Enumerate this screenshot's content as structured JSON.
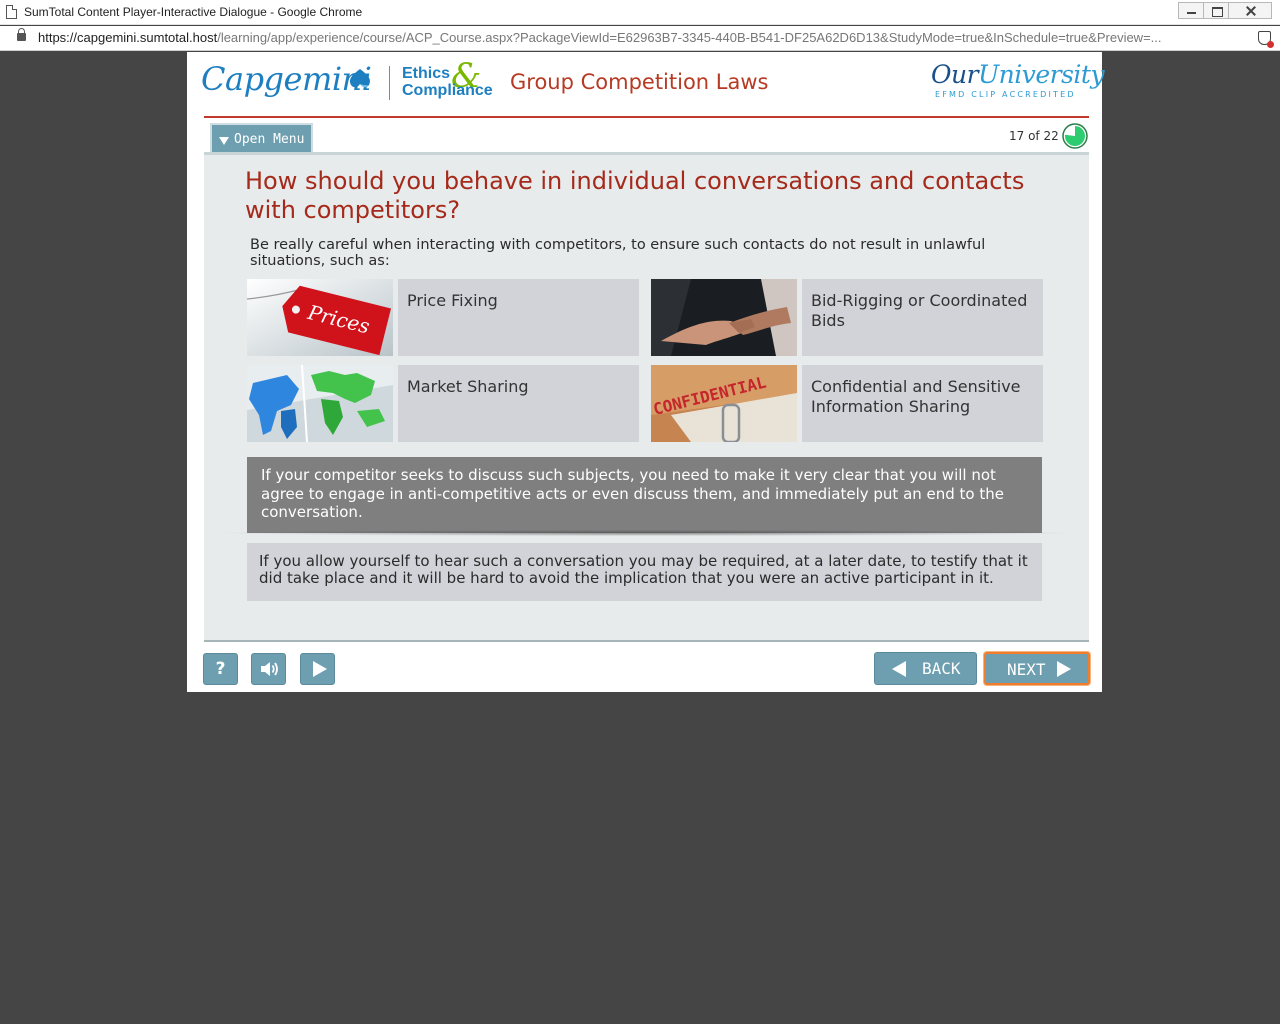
{
  "window": {
    "title": "SumTotal Content Player-Interactive Dialogue - Google Chrome"
  },
  "address_bar": {
    "host": "https://capgemini.sumtotal.host",
    "path": "/learning/app/experience/course/ACP_Course.aspx?PackageViewId=E62963B7-3345-440B-B541-DF25A62D6D13&StudyMode=true&InSchedule=true&Preview=..."
  },
  "header": {
    "brand": "Capgemini",
    "ethics_line1": "Ethics",
    "ethics_amp": "&",
    "ethics_line2": "Compliance",
    "course_title": "Group Competition Laws",
    "ou_part1": "Our",
    "ou_part2": "University",
    "ou_sub": "EFMD CLIP ACCREDITED"
  },
  "nav": {
    "menu_label": "Open Menu",
    "progress_text": "17 of 22",
    "progress_fraction": 0.77
  },
  "slide": {
    "question": "How should you behave in individual conversations and contacts with competitors?",
    "intro": "Be really careful when interacting with competitors, to ensure such contacts do not result in unlawful situations, such as:",
    "cards": [
      {
        "label": "Price Fixing",
        "image_text": "Prices"
      },
      {
        "label": "Bid-Rigging or Coordinated Bids"
      },
      {
        "label": "Market Sharing"
      },
      {
        "label": "Confidential and Sensitive Information Sharing",
        "image_text": "CONFIDENTIAL"
      }
    ],
    "banner": "If your competitor seeks to discuss such subjects, you need to make it very clear that you will not agree to engage in anti-competitive acts or even discuss them, and immediately put an end to the conversation.",
    "note": "If you allow yourself to hear such a conversation you may be required, at a later date, to testify that it did take place and it will be hard to avoid the implication that you were an active participant in it."
  },
  "footer": {
    "help_glyph": "?",
    "back_label": "BACK",
    "next_label": "NEXT"
  },
  "colors": {
    "brand_blue": "#1e7fc0",
    "accent_red": "#b73a23",
    "button_teal": "#6d9fb0",
    "next_highlight": "#f07d2b",
    "progress_green": "#2ecc71"
  }
}
